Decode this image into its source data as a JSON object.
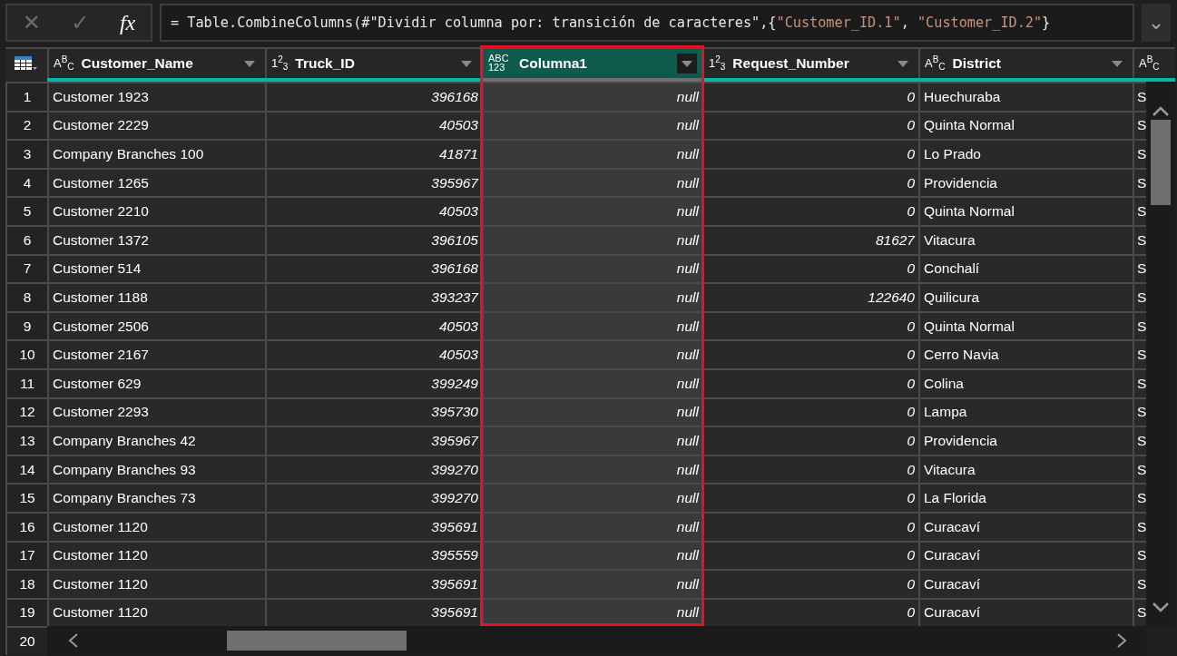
{
  "formula_bar": {
    "buttons": [
      {
        "label": "✕",
        "disabled": true
      },
      {
        "label": "✓",
        "disabled": true
      },
      {
        "label": "fx",
        "disabled": false
      }
    ],
    "formula": [
      {
        "kind": "code",
        "text": "= Table.CombineColumns(#\"Dividir columna por: transición de caracteres\",{"
      },
      {
        "kind": "string",
        "text": "\"Customer_ID.1\""
      },
      {
        "kind": "code",
        "text": ", "
      },
      {
        "kind": "string",
        "text": "\"Customer_ID.2\""
      },
      {
        "kind": "code",
        "text": "}"
      }
    ],
    "expand": "⌄"
  },
  "table": {
    "columns": [
      {
        "type_label": "A$^{B}$$_{C}$",
        "name": "Customer_Name",
        "kind": "text",
        "selected": false,
        "color": "#01b8aa"
      },
      {
        "type_label": "1$^{2}$$_{3}$",
        "name": "Truck_ID",
        "kind": "number",
        "selected": false,
        "color": "#01b8aa"
      },
      {
        "type_label": "ABC 123",
        "name": "Columna1",
        "kind": "any",
        "selected": true,
        "color": "#6e6e6e"
      },
      {
        "type_label": "1$^{2}$$_{3}$",
        "name": "Request_Number",
        "kind": "number",
        "selected": false,
        "color": "#01b8aa"
      },
      {
        "type_label": "A$^{B}$$_{C}$",
        "name": "District",
        "kind": "text",
        "selected": false,
        "color": "#01b8aa"
      },
      {
        "type_label": "A$^{B}$$_{C}$",
        "kind": "text",
        "selected": false,
        "color": "#01b8aa"
      }
    ],
    "rows": [
      {
        "number": "1",
        "cells": [
          "Customer 1923",
          "396168",
          "null",
          "0",
          "Huechuraba",
          "S"
        ]
      },
      {
        "number": "2",
        "cells": [
          "Customer 2229",
          "40503",
          "null",
          "0",
          "Quinta Normal",
          "S"
        ]
      },
      {
        "number": "3",
        "cells": [
          "Company Branches 100",
          "41871",
          "null",
          "0",
          "Lo Prado",
          "S"
        ]
      },
      {
        "number": "4",
        "cells": [
          "Customer 1265",
          "395967",
          "null",
          "0",
          "Providencia",
          "S"
        ]
      },
      {
        "number": "5",
        "cells": [
          "Customer 2210",
          "40503",
          "null",
          "0",
          "Quinta Normal",
          "S"
        ]
      },
      {
        "number": "6",
        "cells": [
          "Customer 1372",
          "396105",
          "null",
          "81627",
          "Vitacura",
          "S"
        ]
      },
      {
        "number": "7",
        "cells": [
          "Customer 514",
          "396168",
          "null",
          "0",
          "Conchalí",
          "S"
        ]
      },
      {
        "number": "8",
        "cells": [
          "Customer 1188",
          "393237",
          "null",
          "122640",
          "Quilicura",
          "S"
        ]
      },
      {
        "number": "9",
        "cells": [
          "Customer 2506",
          "40503",
          "null",
          "0",
          "Quinta Normal",
          "S"
        ]
      },
      {
        "number": "10",
        "cells": [
          "Customer 2167",
          "40503",
          "null",
          "0",
          "Cerro Navia",
          "S"
        ]
      },
      {
        "number": "11",
        "cells": [
          "Customer 629",
          "399249",
          "null",
          "0",
          "Colina",
          "S"
        ]
      },
      {
        "number": "12",
        "cells": [
          "Customer 2293",
          "395730",
          "null",
          "0",
          "Lampa",
          "S"
        ]
      },
      {
        "number": "13",
        "cells": [
          "Company Branches 42",
          "395967",
          "null",
          "0",
          "Providencia",
          "S"
        ]
      },
      {
        "number": "14",
        "cells": [
          "Company Branches 93",
          "399270",
          "null",
          "0",
          "Vitacura",
          "S"
        ]
      },
      {
        "number": "15",
        "cells": [
          "Company Branches 73",
          "399270",
          "null",
          "0",
          "La Florida",
          "S"
        ]
      },
      {
        "number": "16",
        "cells": [
          "Customer 1120",
          "395691",
          "null",
          "0",
          "Curacaví",
          "S"
        ]
      },
      {
        "number": "17",
        "cells": [
          "Customer 1120",
          "395559",
          "null",
          "0",
          "Curacaví",
          "S"
        ]
      },
      {
        "number": "18",
        "cells": [
          "Customer 1120",
          "395691",
          "null",
          "0",
          "Curacaví",
          "S"
        ]
      },
      {
        "number": "19",
        "cells": [
          "Customer 1120",
          "395691",
          "null",
          "0",
          "Curacaví",
          "S"
        ]
      },
      {
        "number": "20",
        "cells": []
      }
    ]
  }
}
